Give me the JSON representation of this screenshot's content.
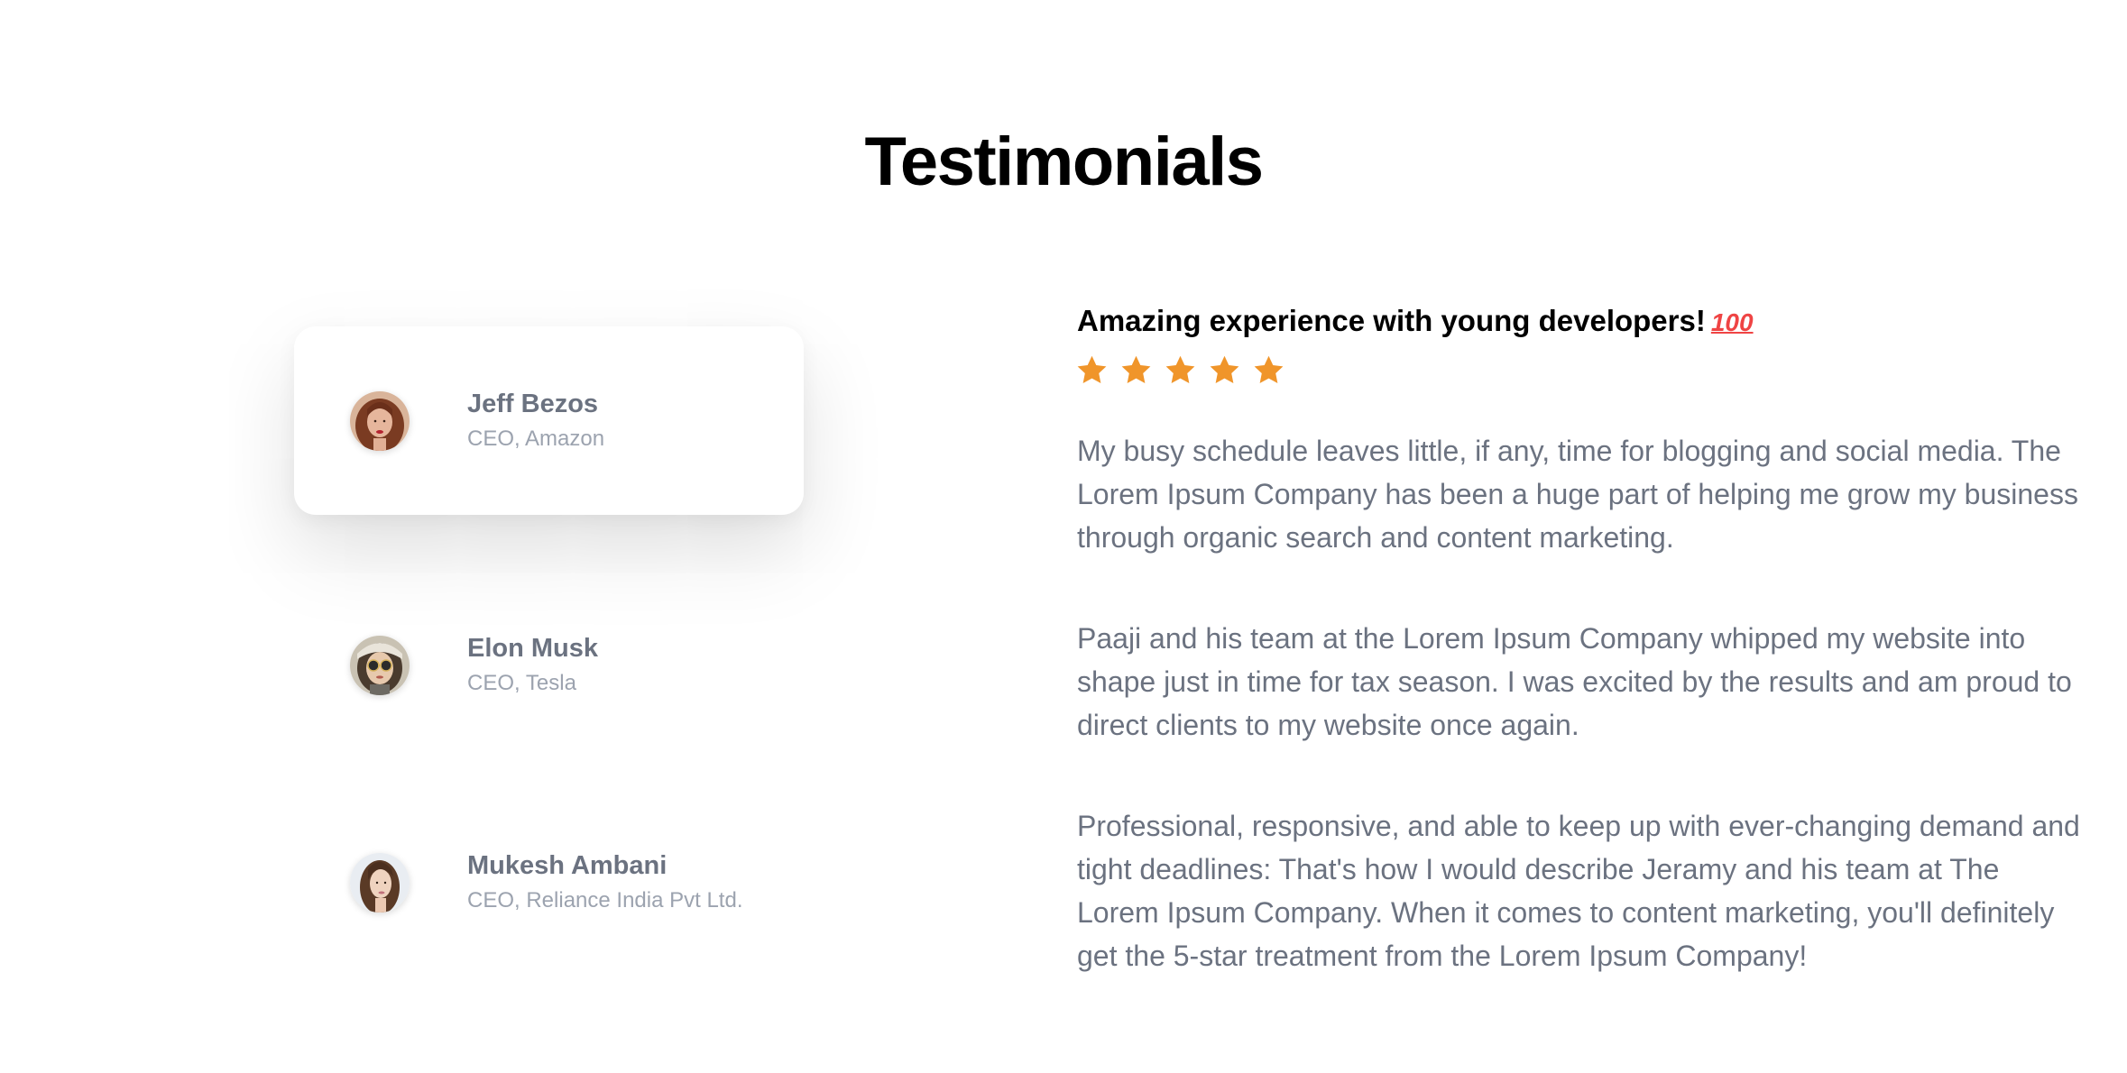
{
  "section": {
    "title": "Testimonials"
  },
  "people": [
    {
      "name": "Jeff Bezos",
      "role": "CEO, Amazon",
      "avatar_icon": "avatar-woman-red-hair"
    },
    {
      "name": "Elon Musk",
      "role": "CEO, Tesla",
      "avatar_icon": "avatar-woman-sunglasses"
    },
    {
      "name": "Mukesh Ambani",
      "role": "CEO, Reliance India Pvt Ltd.",
      "avatar_icon": "avatar-woman-brown-hair"
    }
  ],
  "active_index": 0,
  "review": {
    "headline": "Amazing experience with young developers!",
    "headline_emoji": "100",
    "rating": 5,
    "rating_max": 5,
    "paragraphs": [
      "My busy schedule leaves little, if any, time for blogging and social media. The Lorem Ipsum Company has been a huge part of helping me grow my business through organic search and content marketing.",
      "Paaji and his team at the Lorem Ipsum Company whipped my website into shape just in time for tax season. I was excited by the results and am proud to direct clients to my website once again.",
      "Professional, responsive, and able to keep up with ever-changing demand and tight deadlines: That's how I would describe Jeramy and his team at The Lorem Ipsum Company. When it comes to content marketing, you'll definitely get the 5-star treatment from the Lorem Ipsum Company!"
    ]
  },
  "colors": {
    "star": "#f0952a",
    "name_text": "#6b7280",
    "role_text": "#9ca3af",
    "quote_text": "#6b7280",
    "heading_text": "#000000",
    "emoji": "#ef4444"
  }
}
